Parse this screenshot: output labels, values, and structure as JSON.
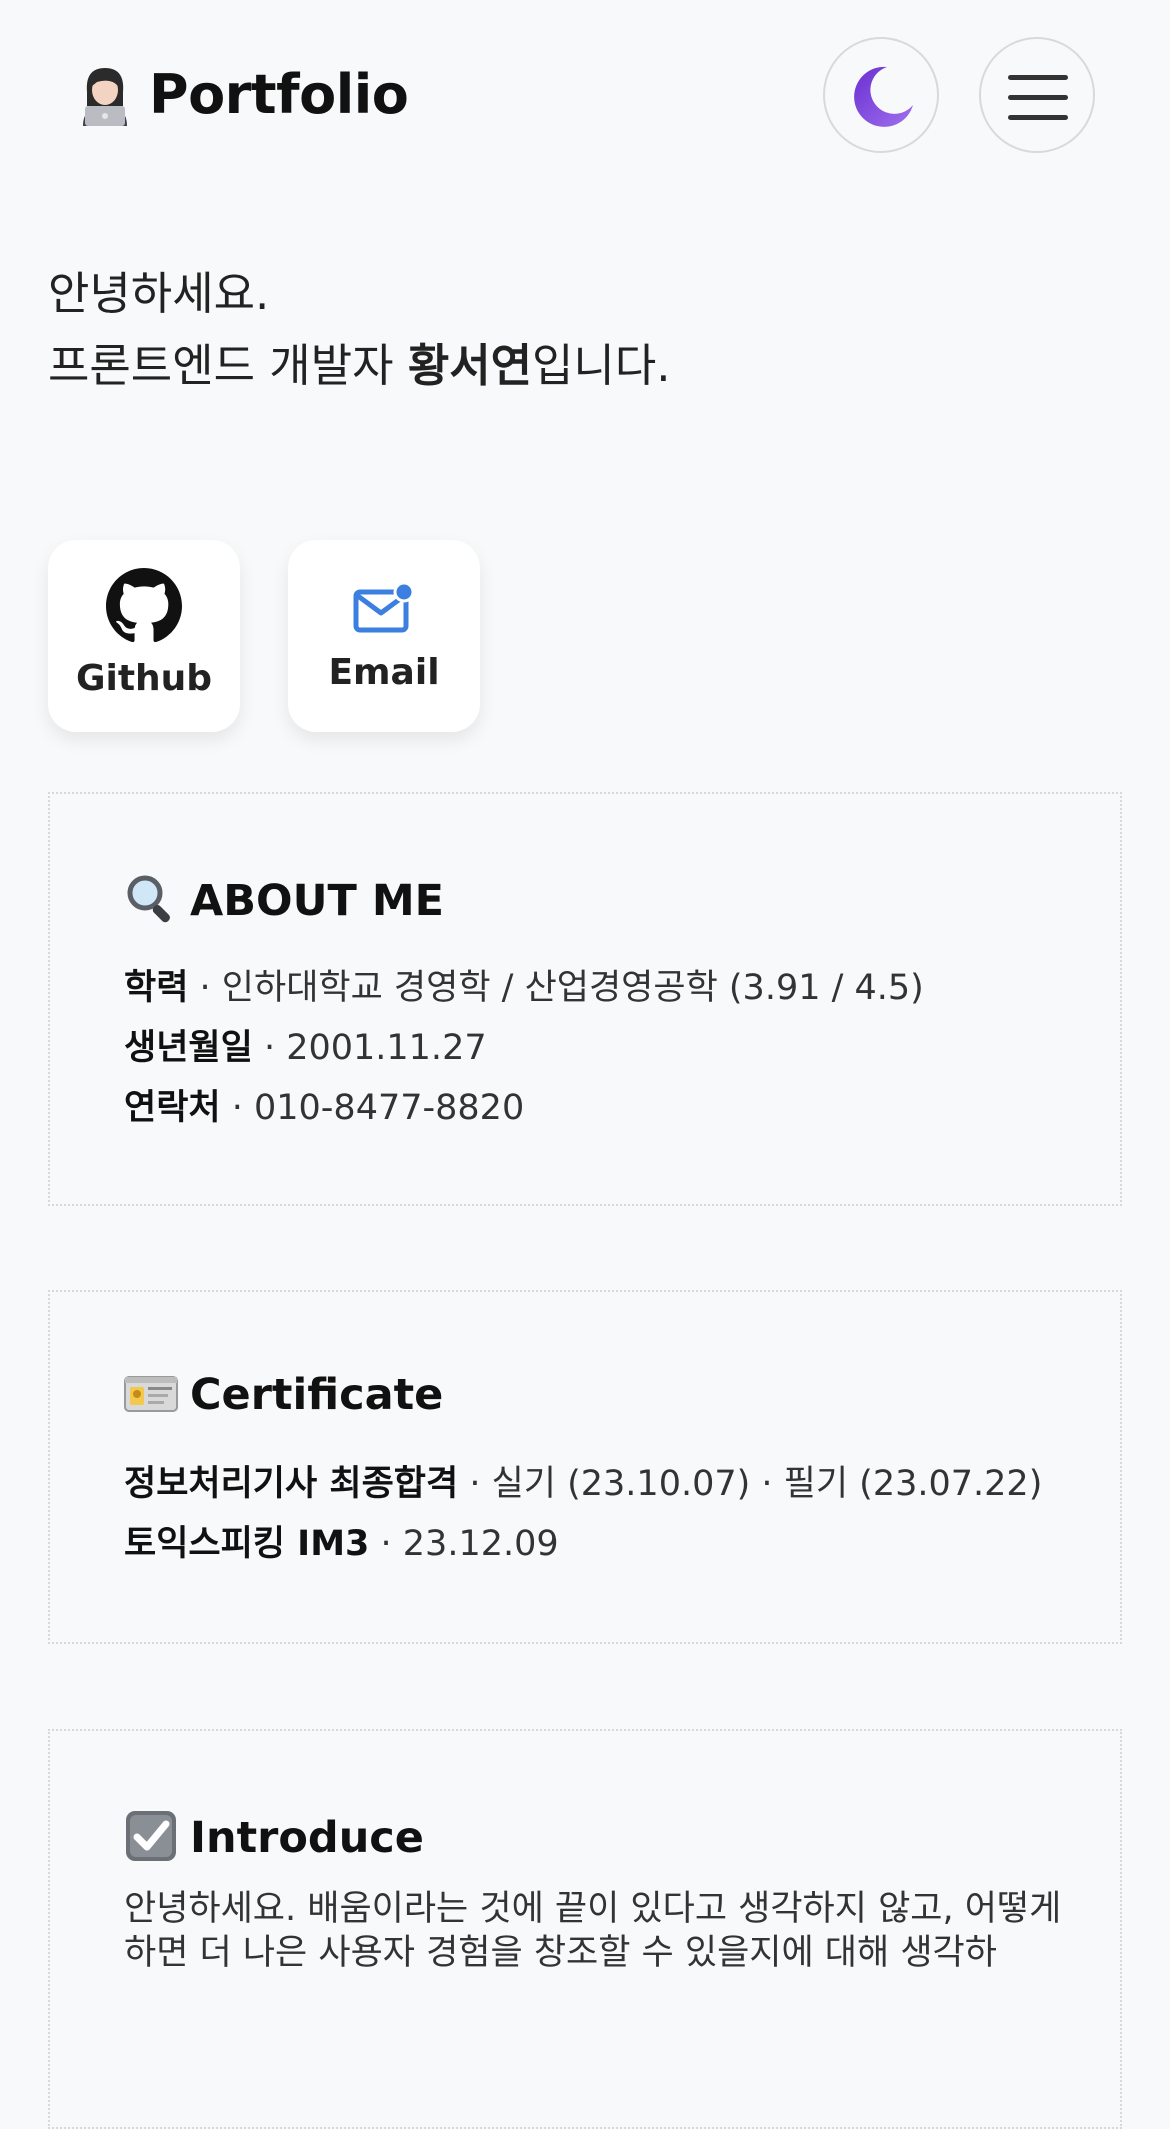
{
  "header": {
    "brand_emoji": "technologist-emoji",
    "brand_title": "Portfolio",
    "theme_icon": "moon-icon",
    "menu_icon": "hamburger-menu-icon"
  },
  "hero": {
    "line1": "안녕하세요.",
    "line2_prefix": "프론트엔드 개발자 ",
    "name": "황서연",
    "line2_suffix": "입니다."
  },
  "links": [
    {
      "label": "Github",
      "icon": "github-icon"
    },
    {
      "label": "Email",
      "icon": "email-icon"
    }
  ],
  "about": {
    "icon": "magnifier-icon",
    "title": "ABOUT ME",
    "rows": [
      {
        "key": "학력",
        "sep": " · ",
        "value": "인하대학교 경영학 / 산업경영공학 (3.91 / 4.5)"
      },
      {
        "key": "생년월일",
        "sep": " · ",
        "value": "2001.11.27"
      },
      {
        "key": "연락처",
        "sep": " · ",
        "value": "010-8477-8820"
      }
    ]
  },
  "certificate": {
    "icon": "id-card-icon",
    "title": "Certificate",
    "rows": [
      {
        "key": "정보처리기사 최종합격",
        "sep": " · ",
        "value": "실기 (23.10.07) · 필기 (23.07.22)"
      },
      {
        "key": "토익스피킹 IM3",
        "sep": " · ",
        "value": "23.12.09"
      }
    ]
  },
  "introduce": {
    "icon": "checkbox-icon",
    "title": "Introduce",
    "text": "안녕하세요. 배움이라는 것에 끝이 있다고 생각하지 않고, 어떻게 하면 더 나은 사용자 경험을 창조할 수 있을지에 대해 생각하"
  },
  "colors": {
    "background": "#f8f9fa",
    "email_accent": "#3b7fe0",
    "moon": "#7c3fd6"
  }
}
